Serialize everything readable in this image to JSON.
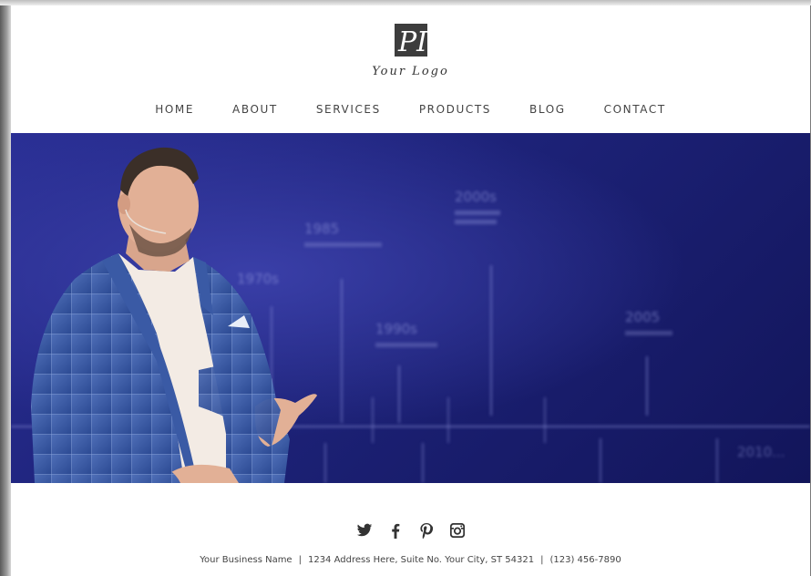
{
  "brand": {
    "logo_text": "Your Logo",
    "logo_mark_letters": "PI",
    "color": "#3d3d3d"
  },
  "nav": {
    "items": [
      {
        "label": "HOME"
      },
      {
        "label": "ABOUT"
      },
      {
        "label": "SERVICES"
      },
      {
        "label": "PRODUCTS"
      },
      {
        "label": "BLOG"
      },
      {
        "label": "CONTACT"
      }
    ]
  },
  "hero": {
    "background_color": "#1d2278",
    "timeline_labels": [
      {
        "year": "2000s"
      },
      {
        "year": "1985"
      },
      {
        "year": "1970s"
      },
      {
        "year": "1990s"
      },
      {
        "year": "2005"
      },
      {
        "year": "2010..."
      }
    ]
  },
  "social": {
    "icons": [
      "twitter-icon",
      "facebook-icon",
      "pinterest-icon",
      "instagram-icon"
    ]
  },
  "footer": {
    "business_name": "Your Business Name",
    "address": "1234 Address Here, Suite No. Your City, ST 54321",
    "phone": "(123) 456-7890",
    "separator": "|"
  }
}
